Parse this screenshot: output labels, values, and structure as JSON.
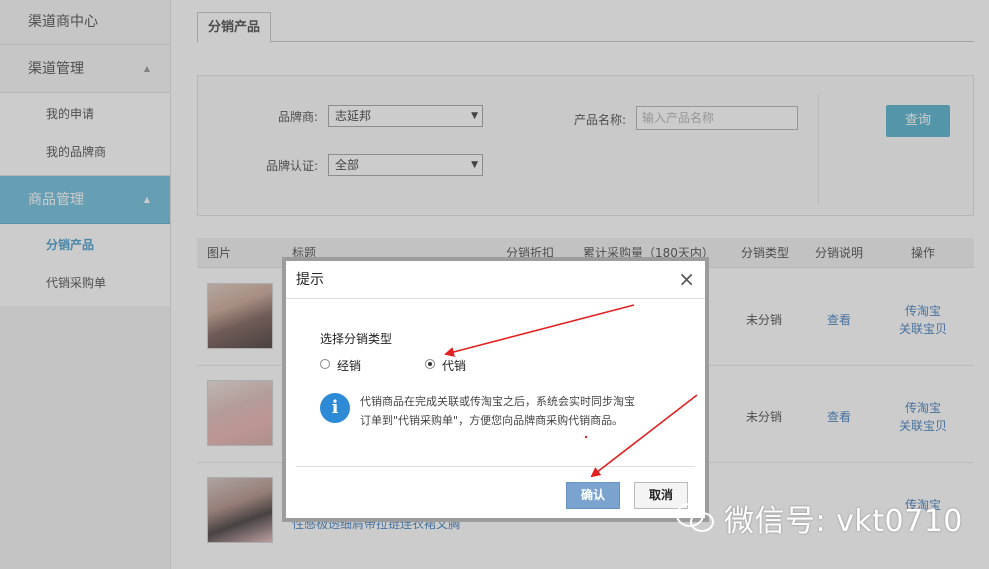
{
  "sidebar": {
    "header": "渠道商中心",
    "groups": [
      {
        "label": "渠道管理",
        "items": [
          "我的申请",
          "我的品牌商"
        ]
      },
      {
        "label": "商品管理",
        "items": [
          "分销产品",
          "代销采购单"
        ]
      }
    ]
  },
  "tabs": {
    "active": "分销产品"
  },
  "filter": {
    "brand_label": "品牌商:",
    "brand_value": "志延邦",
    "cert_label": "品牌认证:",
    "cert_value": "全部",
    "product_label": "产品名称:",
    "product_placeholder": "输入产品名称",
    "query_button": "查询"
  },
  "table": {
    "headers": [
      "图片",
      "标题",
      "分销折扣",
      "累计采购量（180天内）",
      "分销类型",
      "分销说明",
      "操作"
    ],
    "rows": [
      {
        "type": "未分销",
        "desc_link": "查看",
        "ops": [
          "传淘宝",
          "关联宝贝"
        ]
      },
      {
        "type": "未分销",
        "desc_link": "查看",
        "ops": [
          "传淘宝",
          "关联宝贝"
        ]
      },
      {
        "type": "",
        "desc_link": "",
        "ops": [
          "传淘宝",
          ""
        ],
        "title": "性感极透细肩带拉链连衣裙文胸"
      }
    ]
  },
  "dialog": {
    "title": "提示",
    "close_glyph": "×",
    "choose_label": "选择分销类型",
    "options": [
      {
        "label": "经销",
        "checked": false
      },
      {
        "label": "代销",
        "checked": true
      }
    ],
    "info_line1": "代销商品在完成关联或传淘宝之后，系统会实时同步淘宝",
    "info_line2": "订单到\"代销采购单\"，方便您向品牌商采购代销商品。",
    "ok_button": "确认",
    "cancel_button": "取消"
  },
  "watermark": {
    "text": "微信号: vkt0710"
  },
  "colors": {
    "accent": "#5bb5d8",
    "query": "#3da8c9",
    "arrow": "#e32020",
    "info": "#2d8bd6"
  }
}
